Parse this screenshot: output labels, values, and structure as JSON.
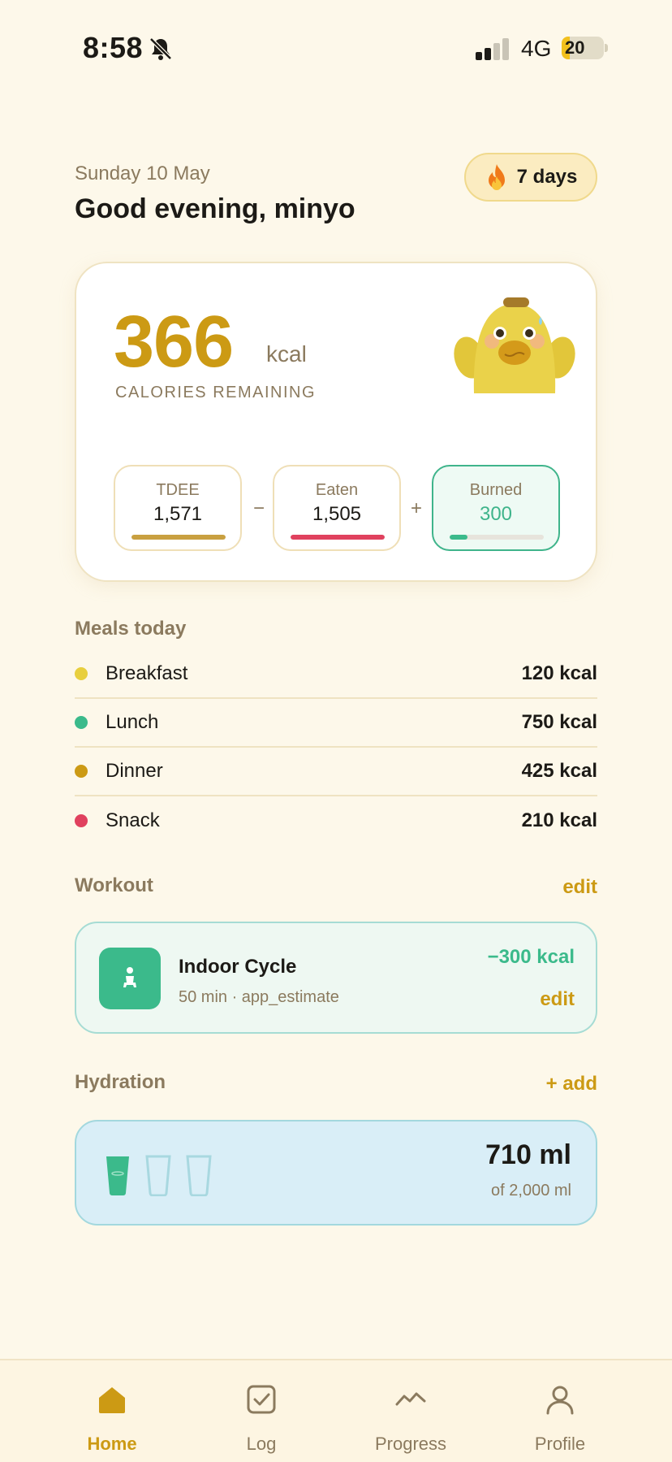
{
  "status_bar": {
    "time": "8:58",
    "network": "4G",
    "battery": "20",
    "battery_level": 0.2
  },
  "header": {
    "date": "Sunday 10 May",
    "greeting": "Good evening, minyo",
    "streak": "7 days"
  },
  "calories": {
    "remaining": "366",
    "unit": "kcal",
    "label": "CALORIES REMAINING",
    "stats": [
      {
        "label": "TDEE",
        "value": "1,571",
        "bar_color": "#c9a040",
        "fill": 1.0
      },
      {
        "label": "Eaten",
        "value": "1,505",
        "bar_color": "#e0415e",
        "fill": 1.0
      },
      {
        "label": "Burned",
        "value": "300",
        "bar_color": "#3bba8b",
        "fill": 0.19
      }
    ],
    "op_minus": "−",
    "op_plus": "+"
  },
  "meals": {
    "title": "Meals today",
    "items": [
      {
        "name": "Breakfast",
        "kcal": "120 kcal",
        "color": "#e8cf3e"
      },
      {
        "name": "Lunch",
        "kcal": "750 kcal",
        "color": "#3bba8b"
      },
      {
        "name": "Dinner",
        "kcal": "425 kcal",
        "color": "#cc9a14"
      },
      {
        "name": "Snack",
        "kcal": "210 kcal",
        "color": "#e0415e"
      }
    ]
  },
  "workout": {
    "title": "Workout",
    "action": "edit",
    "name": "Indoor Cycle",
    "meta": "50 min · app_estimate",
    "kcal": "−300 kcal",
    "edit": "edit"
  },
  "hydration": {
    "title": "Hydration",
    "action": "+ add",
    "amount": "710 ml",
    "goal": "of 2,000 ml",
    "cups_filled": 1,
    "cups_total": 3
  },
  "tabs": [
    {
      "label": "Home",
      "icon": "home-icon",
      "active": true
    },
    {
      "label": "Log",
      "icon": "checkbox-icon",
      "active": false
    },
    {
      "label": "Progress",
      "icon": "chart-line-icon",
      "active": false
    },
    {
      "label": "Profile",
      "icon": "person-icon",
      "active": false
    }
  ],
  "colors": {
    "background": "#fdf8ea",
    "accent": "#cc9a14",
    "green": "#3bba8b",
    "red": "#e0415e",
    "muted": "#8b7a5e"
  }
}
